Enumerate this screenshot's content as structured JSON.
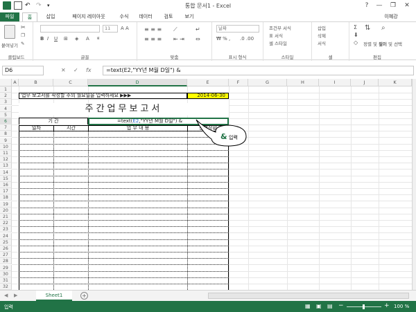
{
  "window": {
    "title": "통합 문서1 - Excel",
    "user": "이혜강",
    "help": "?",
    "minimize": "—",
    "restore": "❐",
    "close": "✕"
  },
  "tabs": [
    "파일",
    "홈",
    "삽입",
    "페이지 레이아웃",
    "수식",
    "데이터",
    "검토",
    "보기"
  ],
  "ribbon": {
    "paste": "붙여넣기",
    "font_size": "11",
    "number_format": "날짜",
    "conditional": "조건부 서식",
    "table_format": "표 서식",
    "cell_style": "셀 스타일",
    "insert": "삽입",
    "delete": "삭제",
    "format": "서식",
    "sort_filter": "정렬 및 필터",
    "find_select": "찾기 및 선택",
    "groups": [
      "클립보드",
      "글꼴",
      "맞춤",
      "표시 형식",
      "스타일",
      "셀",
      "편집"
    ]
  },
  "formula_bar": {
    "name_box": "D6",
    "fx": "fx",
    "formula": "=text(E2,\"YY년 M월 D일\") &"
  },
  "columns": [
    "A",
    "B",
    "C",
    "D",
    "E",
    "F",
    "G",
    "H",
    "I",
    "J",
    "K"
  ],
  "rows": [
    "1",
    "2",
    "3",
    "4",
    "5",
    "6",
    "7",
    "8",
    "9",
    "10",
    "11",
    "12",
    "13",
    "14",
    "15",
    "16",
    "17",
    "18",
    "19",
    "20",
    "21",
    "22",
    "23",
    "24",
    "25",
    "26",
    "27",
    "28",
    "29",
    "30",
    "31",
    "32"
  ],
  "cells": {
    "instruction": "업무 보고서를 작성할 주의 월요일을 입력하세요 ▶▶▶",
    "date": "2014-06-30",
    "report_title": "주간업무보고서",
    "period_label": "기   간",
    "d6_prefix": "=text(",
    "d6_ref": "E2",
    "d6_suffix": ",\"YY년 M월 D일\") &",
    "header_date": "일자",
    "header_time": "시간",
    "header_content": "업 무 내 용",
    "header_progress": "진행상황"
  },
  "callout": {
    "amp": "&",
    "text": "입력"
  },
  "sheet_tab": "Sheet1",
  "status": {
    "mode": "입력",
    "zoom": "100 %",
    "minus": "−",
    "plus": "+"
  }
}
